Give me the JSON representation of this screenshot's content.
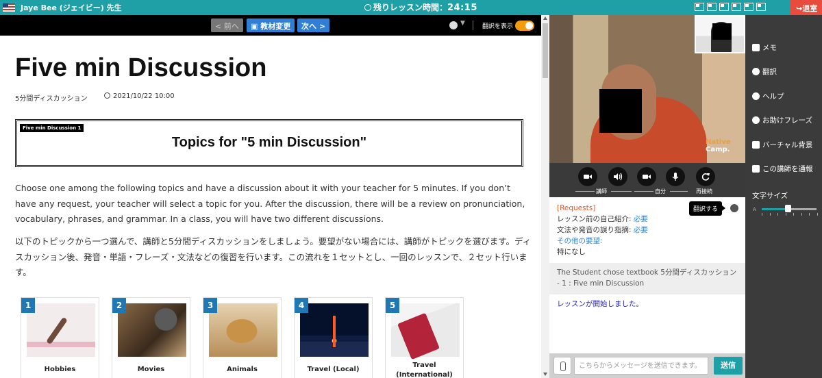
{
  "topbar": {
    "teacher_name": "Jaye Bee (ジェイビー) 先生",
    "timer_label": "残りレッスン時間：",
    "timer_value": "24:15",
    "layout_icons": [
      "layout-1-icon",
      "layout-2-icon",
      "layout-3-icon",
      "layout-4-icon",
      "layout-5-icon",
      "layout-6-icon"
    ],
    "exit_label": "退室"
  },
  "toolbar": {
    "prev_label": "< 前へ",
    "change_label": "教材変更",
    "next_label": "次へ >",
    "translate_label": "翻訳を表示",
    "translate_on": true
  },
  "material": {
    "title": "Five min Discussion",
    "subtitle": "5分間ディスカッション",
    "date": "2021/10/22 10:00",
    "topic_tag": "Five min Discussion 1",
    "topic_heading": "Topics for \"5 min Discussion\"",
    "para_en": "Choose one among the following topics and have a discussion about it with your teacher for 5 minutes. If you don’t have any request, your teacher will select a topic for you. After the discussion, there will be a review on pronunciation, vocabulary, phrases, and grammar. In a class, you will have two different discussions.",
    "para_ja": "以下のトピックから一つ選んで、講師と5分間ディスカッションをしましょう。要望がない場合には、講師がトピックを選びます。ディスカッション後、発音・単語・フレーズ・文法などの復習を行います。この流れを１セットとし、一回のレッスンで、２セット行います。",
    "cards": [
      {
        "num": "1",
        "label": "Hobbies"
      },
      {
        "num": "2",
        "label": "Movies"
      },
      {
        "num": "3",
        "label": "Animals"
      },
      {
        "num": "4",
        "label": "Travel (Local)"
      },
      {
        "num": "5",
        "label": "Travel (International)"
      }
    ]
  },
  "video": {
    "brand_line1": "Native",
    "brand_line2": "Camp.",
    "controls": {
      "teacher_label": "講師",
      "self_label": "自分",
      "reconnect_label": "再接続"
    }
  },
  "chat": {
    "req_header": "[Requests]",
    "req_intro_label": "レッスン前の自己紹介: ",
    "req_intro_value": "必要",
    "req_correction_label": "文法や発音の誤り指摘: ",
    "req_correction_value": "必要",
    "req_other_label": "その他の要望:",
    "req_other_value": "特になし",
    "translate_tooltip": "翻訳する",
    "system_message": "The Student chose textbook 5分間ディスカッション - 1 : Five min Discussion",
    "started_message": "レッスンが開始しました。",
    "input_placeholder": "こちらからメッセージを送信できます。",
    "send_label": "送信"
  },
  "side_menu": {
    "memo": "メモ",
    "translate": "翻訳",
    "help": "ヘルプ",
    "phrases": "お助けフレーズ",
    "background": "バーチャル背景",
    "report": "この講師を通報",
    "font_size_label": "文字サイズ",
    "font_size_small": "A",
    "font_size_level": 0.45
  },
  "colors": {
    "accent": "#1ea0a6",
    "button_blue": "#2f7fd6",
    "exit_red": "#e74c3c",
    "toggle_orange": "#f39c12",
    "request_header": "#e2572a",
    "link_blue": "#2f86d6"
  }
}
